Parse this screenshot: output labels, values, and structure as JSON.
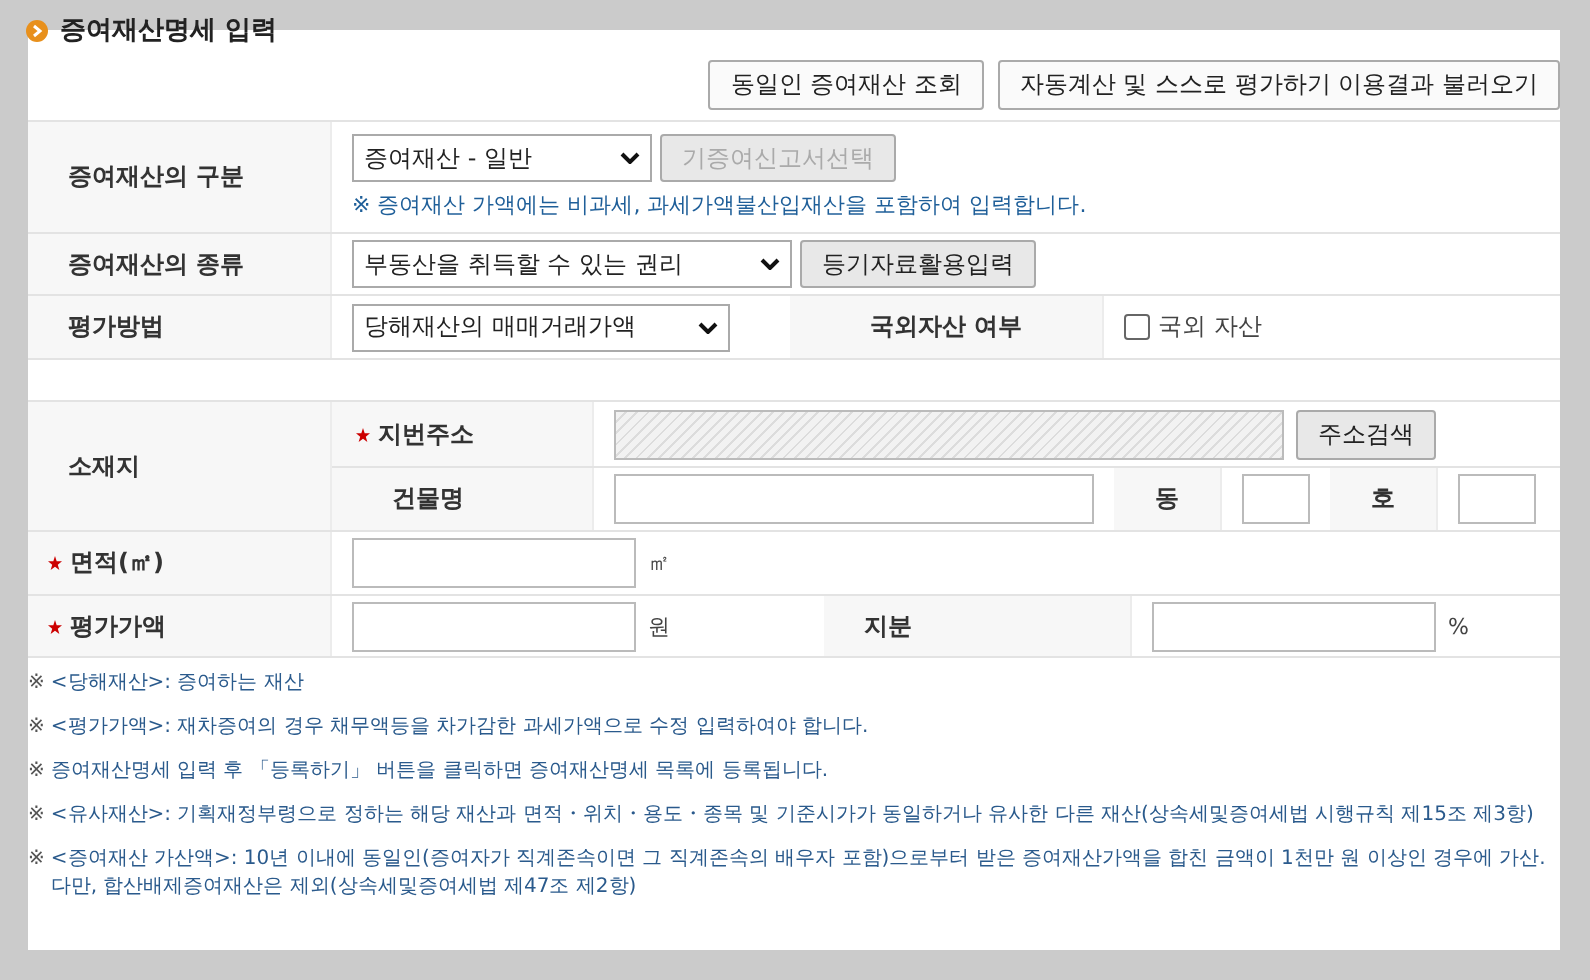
{
  "title": "증여재산명세 입력",
  "top_buttons": [
    {
      "label": "동일인 증여재산 조회"
    },
    {
      "label": "자동계산 및 스스로 평가하기 이용결과 불러오기"
    }
  ],
  "gift_type": {
    "label": "증여재산의 구분",
    "value": "증여재산 - 일반",
    "button": {
      "label": "기증여신고서선택",
      "disabled": true
    },
    "note": "※ 증여재산 가액에는 비과세, 과세가액불산입재산을 포함하여 입력합니다."
  },
  "property_type": {
    "label": "증여재산의 종류",
    "value": "부동산을 취득할 수 있는 권리",
    "button": {
      "label": "등기자료활용입력",
      "disabled": false
    }
  },
  "valuation": {
    "label": "평가방법",
    "value": "당해재산의 매매거래가액",
    "foreign_label": "국외자산 여부",
    "foreign_checkbox": {
      "label": "국외 자산",
      "checked": false
    }
  },
  "location": {
    "label": "소재지",
    "lot_address": {
      "label": "지번주소",
      "required": true,
      "disabled": true
    },
    "search_button": "주소검색",
    "building": {
      "label": "건물명"
    },
    "dong": "동",
    "ho": "호"
  },
  "area": {
    "label": "면적(㎡)",
    "required": true,
    "unit": "㎡"
  },
  "price": {
    "label": "평가가액",
    "required": true,
    "unit": "원",
    "share_label": "지분",
    "share_unit": "%"
  },
  "notes": [
    {
      "mark": "※",
      "text": "<당해재산>: 증여하는 재산"
    },
    {
      "mark": "※",
      "text": "<평가가액>: 재차증여의 경우 채무액등을 차가감한 과세가액으로 수정 입력하여야 합니다."
    },
    {
      "mark": "※",
      "text": "증여재산명세 입력 후 「등록하기」 버튼을 클릭하면 증여재산명세 목록에 등록됩니다."
    },
    {
      "mark": "※",
      "text": "<유사재산>: 기획재정부령으로 정하는 해당 재산과 면적・위치・용도・종목 및 기준시가가 동일하거나 유사한 다른 재산(상속세및증여세법 시행규칙 제15조 제3항)"
    },
    {
      "mark": "※",
      "text": "<증여재산 가산액>: 10년 이내에 동일인(증여자가 직계존속이면 그 직계존속의 배우자 포함)으로부터 받은 증여재산가액을 합친 금액이 1천만 원 이상인 경우에 가산. 다만, 합산배제증여재산은 제외(상속세및증여세법 제47조 제2항)"
    }
  ]
}
